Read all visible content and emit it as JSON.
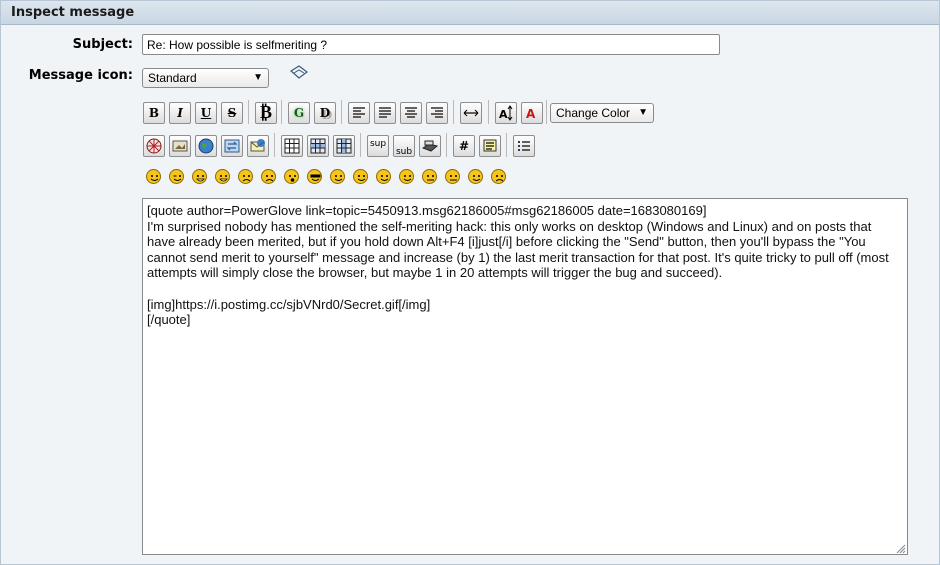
{
  "window": {
    "title": "Inspect message"
  },
  "form": {
    "subject_label": "Subject:",
    "subject_value": "Re: How possible is selfmeriting ?",
    "icon_label": "Message icon:",
    "icon_selected": "Standard",
    "icon_name": "xx-icon"
  },
  "toolbar1": {
    "buttons": [
      {
        "name": "bold-button",
        "text": "B"
      },
      {
        "name": "italic-button",
        "text": "I"
      },
      {
        "name": "underline-button",
        "text": "U"
      },
      {
        "name": "strikethrough-button",
        "text": "S"
      },
      {
        "name": "bitcoin-button",
        "text": "₿"
      },
      {
        "name": "glow-button",
        "text": "G"
      },
      {
        "name": "shadow-button",
        "text": "D"
      },
      {
        "name": "align-left-button",
        "icon": "align-left-icon"
      },
      {
        "name": "align-justify-button",
        "icon": "align-justify-icon"
      },
      {
        "name": "align-center-button",
        "icon": "align-center-icon"
      },
      {
        "name": "align-right-button",
        "icon": "align-right-icon"
      },
      {
        "name": "hr-button",
        "icon": "horizontal-rule-icon"
      },
      {
        "name": "font-size-button",
        "icon": "font-size-icon"
      },
      {
        "name": "font-face-button",
        "icon": "font-face-icon"
      }
    ],
    "color_select": "Change Color"
  },
  "toolbar2": {
    "buttons": [
      {
        "name": "flash-button",
        "icon": "flash-icon"
      },
      {
        "name": "image-button",
        "icon": "image-icon"
      },
      {
        "name": "hyperlink-button",
        "icon": "globe-icon"
      },
      {
        "name": "ftp-button",
        "icon": "ftp-icon"
      },
      {
        "name": "email-button",
        "icon": "email-icon"
      },
      {
        "name": "table-button",
        "icon": "table-icon"
      },
      {
        "name": "table-row-button",
        "icon": "table-row-icon"
      },
      {
        "name": "table-column-button",
        "icon": "table-column-icon"
      },
      {
        "name": "superscript-button",
        "text": "sup"
      },
      {
        "name": "subscript-button",
        "text": "sub"
      },
      {
        "name": "teletype-button",
        "icon": "teletype-icon"
      },
      {
        "name": "code-button",
        "text": "#"
      },
      {
        "name": "quote-button",
        "icon": "quote-icon"
      },
      {
        "name": "list-button",
        "icon": "list-icon"
      }
    ]
  },
  "smileys": [
    "smiley-icon",
    "wink-icon",
    "cheesy-icon",
    "grin-icon",
    "angry-icon",
    "sad-icon",
    "shocked-icon",
    "cool-icon",
    "huh-icon",
    "roll-eyes-icon",
    "tongue-icon",
    "embarrassed-icon",
    "lips-sealed-icon",
    "undecided-icon",
    "kiss-icon",
    "cry-icon"
  ],
  "message": {
    "body": "[quote author=PowerGlove link=topic=5450913.msg62186005#msg62186005 date=1683080169]\nI'm surprised nobody has mentioned the self-meriting hack: this only works on desktop (Windows and Linux) and on posts that have already been merited, but if you hold down Alt+F4 [i]just[/i] before clicking the \"Send\" button, then you'll bypass the \"You cannot send merit to yourself\" message and increase (by 1) the last merit transaction for that post. It's quite tricky to pull off (most attempts will simply close the browser, but maybe 1 in 20 attempts will trigger the bug and succeed).\n\n[img]https://i.postimg.cc/sjbVNrd0/Secret.gif[/img]\n[/quote]"
  },
  "colors": {
    "accent": "#c9d6e2",
    "smiley": "#f6c41a"
  }
}
